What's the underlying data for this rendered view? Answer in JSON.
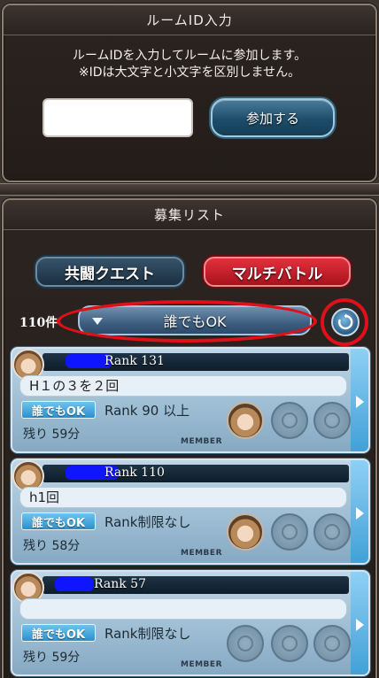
{
  "room": {
    "title": "ルームID入力",
    "desc_line1": "ルームIDを入力してルームに参加します。",
    "desc_line2": "※IDは大文字と小文字を区別しません。",
    "input_value": "",
    "join_label": "参加する"
  },
  "recruit": {
    "title": "募集リスト",
    "tab_coop": "共闘クエスト",
    "tab_multi": "マルチバトル",
    "count": "110件",
    "filter_label": "誰でもOK"
  },
  "cards": [
    {
      "rank": "Rank 131",
      "message": "H１の３を２回",
      "badge": "誰でもOK",
      "rank_limit": "Rank 90 以上",
      "remaining": "残り 59分",
      "member_label": "MEMBER"
    },
    {
      "rank": "Rank 110",
      "message": "h1回",
      "badge": "誰でもOK",
      "rank_limit": "Rank制限なし",
      "remaining": "残り 58分",
      "member_label": "MEMBER"
    },
    {
      "rank": "Rank 57",
      "message": "",
      "badge": "誰でもOK",
      "rank_limit": "Rank制限なし",
      "remaining": "残り 59分",
      "member_label": "MEMBER"
    }
  ],
  "icons": {
    "refresh": "refresh-icon",
    "dropdown": "chevron-down-icon",
    "next": "chevron-right-icon"
  },
  "colors": {
    "highlight": "#e0101a",
    "card_bg": "#9bbcd2",
    "tab_multi": "#d01f2b"
  }
}
